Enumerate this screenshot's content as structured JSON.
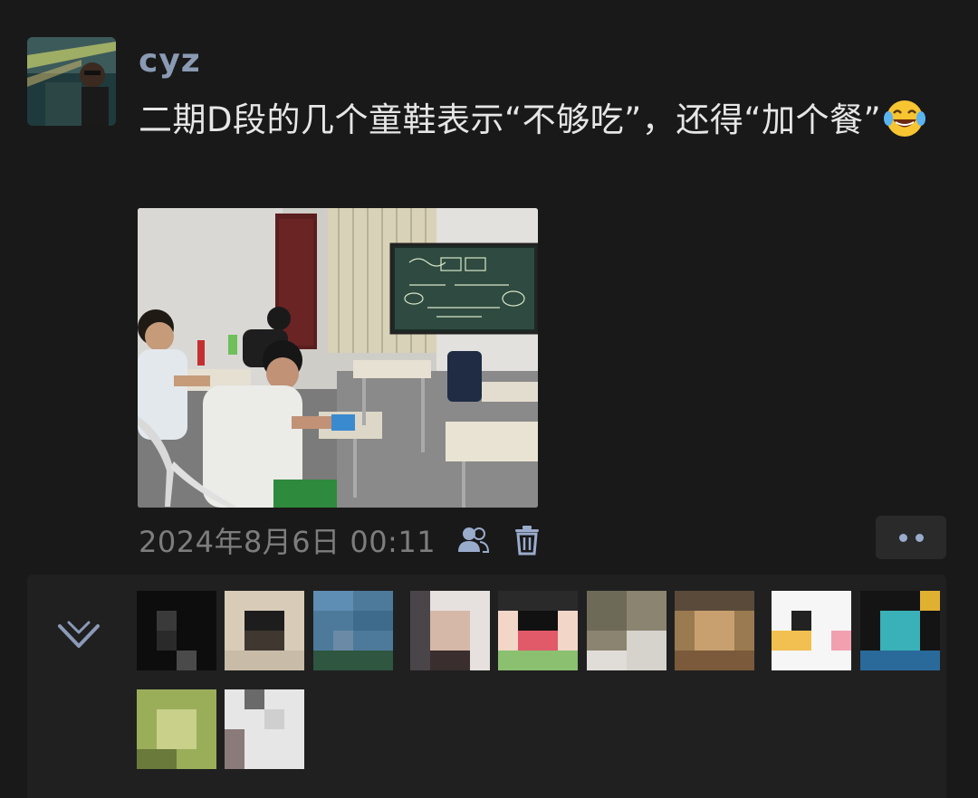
{
  "post": {
    "username": "cyz",
    "text": "二期D段的几个童鞋表示“不够吃”，还得“加个餐”",
    "emoji": "face-with-tears-of-joy",
    "timestamp": "2024年8月6日 00:11"
  },
  "actions": {
    "visibility_icon": "people-icon",
    "delete_icon": "trash-icon",
    "more_icon": "more-dots-icon"
  },
  "likes": {
    "collapse_icon": "chevron-down-icon",
    "count": 11
  },
  "colors": {
    "background": "#191919",
    "panel": "#202020",
    "username": "#8a9ab3",
    "text": "#e6e6e6",
    "timestamp": "#7d7d7d",
    "icon_accent": "#9aaccc"
  }
}
